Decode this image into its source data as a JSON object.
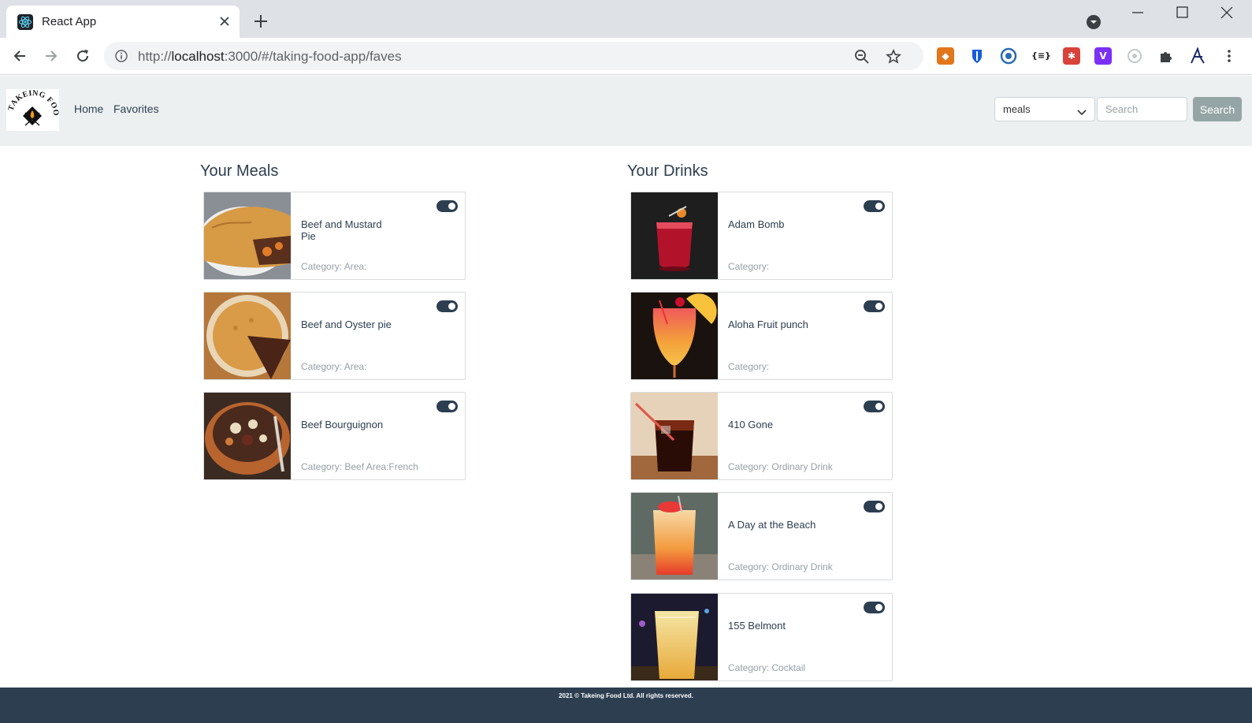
{
  "browser": {
    "tab_title": "React App",
    "url_scheme": "http://",
    "url_host": "localhost",
    "url_rest": ":3000/#/taking-food-app/faves"
  },
  "navbar": {
    "logo_text": "TAKEING FOOD",
    "links": [
      "Home",
      "Favorites"
    ],
    "select_value": "meals",
    "search_placeholder": "Search",
    "search_button": "Search"
  },
  "meals": {
    "title": "Your Meals",
    "items": [
      {
        "name": "Beef and Mustard Pie",
        "meta": "Category:  Area:"
      },
      {
        "name": "Beef and Oyster pie",
        "meta": "Category:  Area:"
      },
      {
        "name": "Beef Bourguignon",
        "meta": "Category: Beef Area:French"
      }
    ]
  },
  "drinks": {
    "title": "Your Drinks",
    "items": [
      {
        "name": "Adam Bomb",
        "meta": "Category:"
      },
      {
        "name": "Aloha Fruit punch",
        "meta": "Category:"
      },
      {
        "name": "410 Gone",
        "meta": "Category: Ordinary Drink"
      },
      {
        "name": "A Day at the Beach",
        "meta": "Category: Ordinary Drink"
      },
      {
        "name": "155 Belmont",
        "meta": "Category: Cocktail"
      }
    ]
  },
  "footer": {
    "text": "2021 © Takeing Food Ltd. All rights reserved."
  },
  "colors": {
    "primary": "#2c3e50",
    "navbar_bg": "#ecf0f1",
    "button": "#95a5a6"
  }
}
